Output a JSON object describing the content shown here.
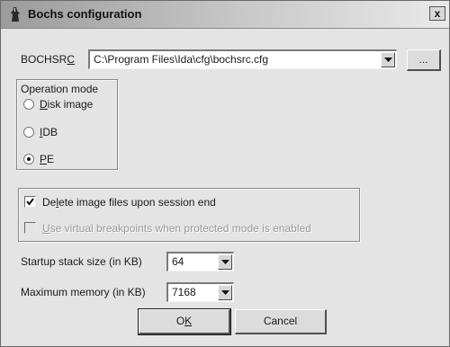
{
  "window": {
    "title": "Bochs configuration",
    "close_glyph": "x"
  },
  "bochsrc": {
    "label_pre": "BOCHSR",
    "label_key": "C",
    "value": "C:\\Program Files\\Ida\\cfg\\bochsrc.cfg",
    "browse_label": "..."
  },
  "operation_mode": {
    "title": "Operation mode",
    "options": [
      {
        "key": "D",
        "rest": "isk image",
        "selected": false
      },
      {
        "key": "I",
        "rest": "DB",
        "selected": false
      },
      {
        "key": "P",
        "rest": "E",
        "selected": true
      }
    ]
  },
  "options": {
    "delete_images": {
      "pre": "De",
      "key": "l",
      "rest": "ete image files upon session end",
      "checked": true,
      "enabled": true
    },
    "virtual_breakpoints": {
      "pre": "",
      "key": "U",
      "rest": "se virtual breakpoints when protected mode is enabled",
      "checked": false,
      "enabled": false
    }
  },
  "stack_size": {
    "label": "Startup stack size (in KB)",
    "value": "64"
  },
  "max_memory": {
    "label": "Maximum memory (in KB)",
    "value": "7168"
  },
  "buttons": {
    "ok_pre": "O",
    "ok_key": "K",
    "cancel": "Cancel"
  },
  "icons": {
    "app": "bochs-app-icon",
    "dropdown": "chevron-down-icon",
    "check": "checkmark-icon"
  }
}
